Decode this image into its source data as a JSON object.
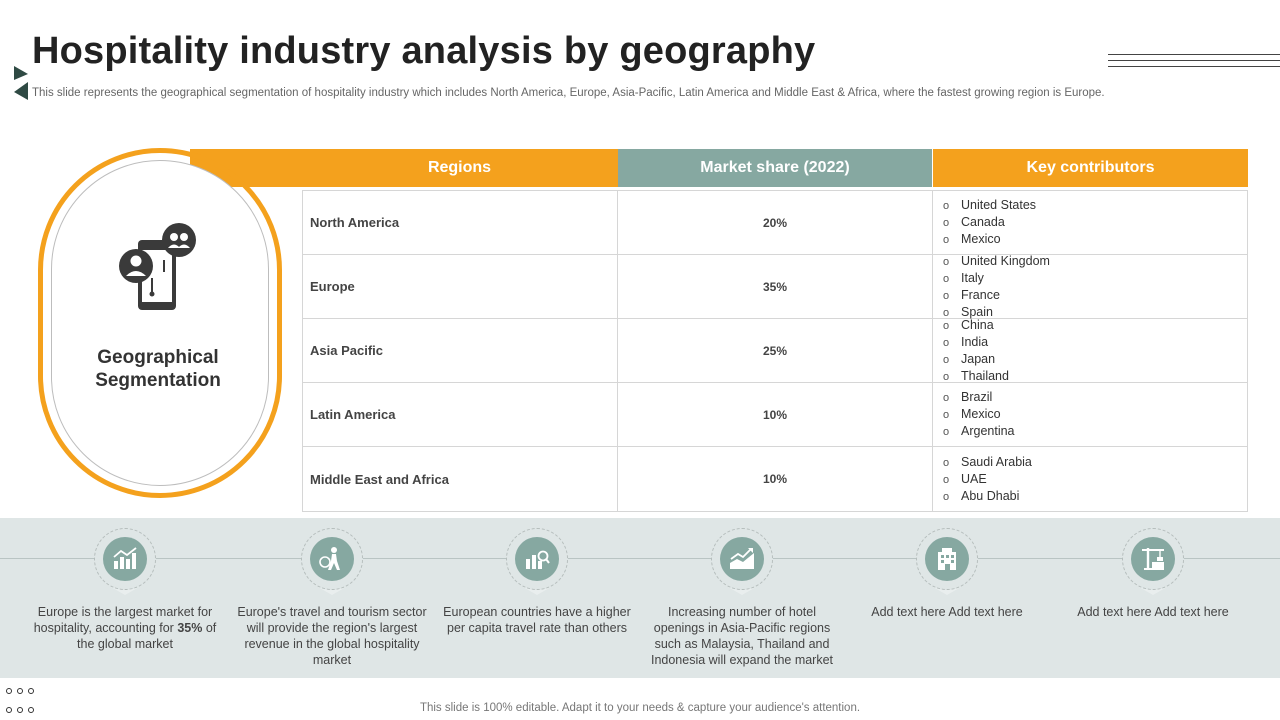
{
  "header": {
    "title": "Hospitality industry analysis by geography",
    "subtitle": "This slide represents the geographical segmentation of hospitality industry which includes North America, Europe, Asia-Pacific, Latin America and Middle East & Africa,  where the fastest growing region is Europe."
  },
  "oval": {
    "label": "Geographical Segmentation",
    "icon": "mobile-users-icon"
  },
  "table": {
    "headers": {
      "regions": "Regions",
      "share": "Market share (2022)",
      "contributors": "Key contributors"
    },
    "rows": [
      {
        "region": "North America",
        "share": "20%",
        "contributors": [
          "United States",
          "Canada",
          "Mexico"
        ]
      },
      {
        "region": "Europe",
        "share": "35%",
        "contributors": [
          "United Kingdom",
          "Italy",
          "France",
          "Spain"
        ]
      },
      {
        "region": "Asia Pacific",
        "share": "25%",
        "contributors": [
          "China",
          "India",
          "Japan",
          "Thailand"
        ]
      },
      {
        "region": "Latin America",
        "share": "10%",
        "contributors": [
          "Brazil",
          "Mexico",
          "Argentina"
        ]
      },
      {
        "region": "Middle East and Africa",
        "share": "10%",
        "contributors": [
          "Saudi Arabia",
          "UAE",
          "Abu Dhabi"
        ]
      }
    ]
  },
  "features": [
    {
      "icon": "growth-chart-icon",
      "text_before": "Europe is the largest market for hospitality, accounting for ",
      "highlight": "35%",
      "text_after": " of the global market"
    },
    {
      "icon": "traveler-icon",
      "text_before": "Europe's travel  and tourism sector will provide  the region's largest revenue  in the global hospitality market",
      "highlight": "",
      "text_after": ""
    },
    {
      "icon": "analytics-chart-icon",
      "text_before": "European  countries have  a higher per  capita travel rate than others",
      "highlight": "",
      "text_after": ""
    },
    {
      "icon": "rising-revenue-icon",
      "text_before": "Increasing number of hotel openings in Asia-Pacific regions such as Malaysia, Thailand  and Indonesia  will expand the market",
      "highlight": "",
      "text_after": ""
    },
    {
      "icon": "hotel-building-icon",
      "text_before": "Add text here Add text here",
      "highlight": "",
      "text_after": ""
    },
    {
      "icon": "construction-crane-icon",
      "text_before": "Add text here Add text here",
      "highlight": "",
      "text_after": ""
    }
  ],
  "footer": {
    "text": "This slide is 100% editable. Adapt it to your needs & capture your audience's attention."
  },
  "colors": {
    "accent": "#f4a11d",
    "teal": "#86a8a1",
    "band": "#dfe6e6"
  }
}
